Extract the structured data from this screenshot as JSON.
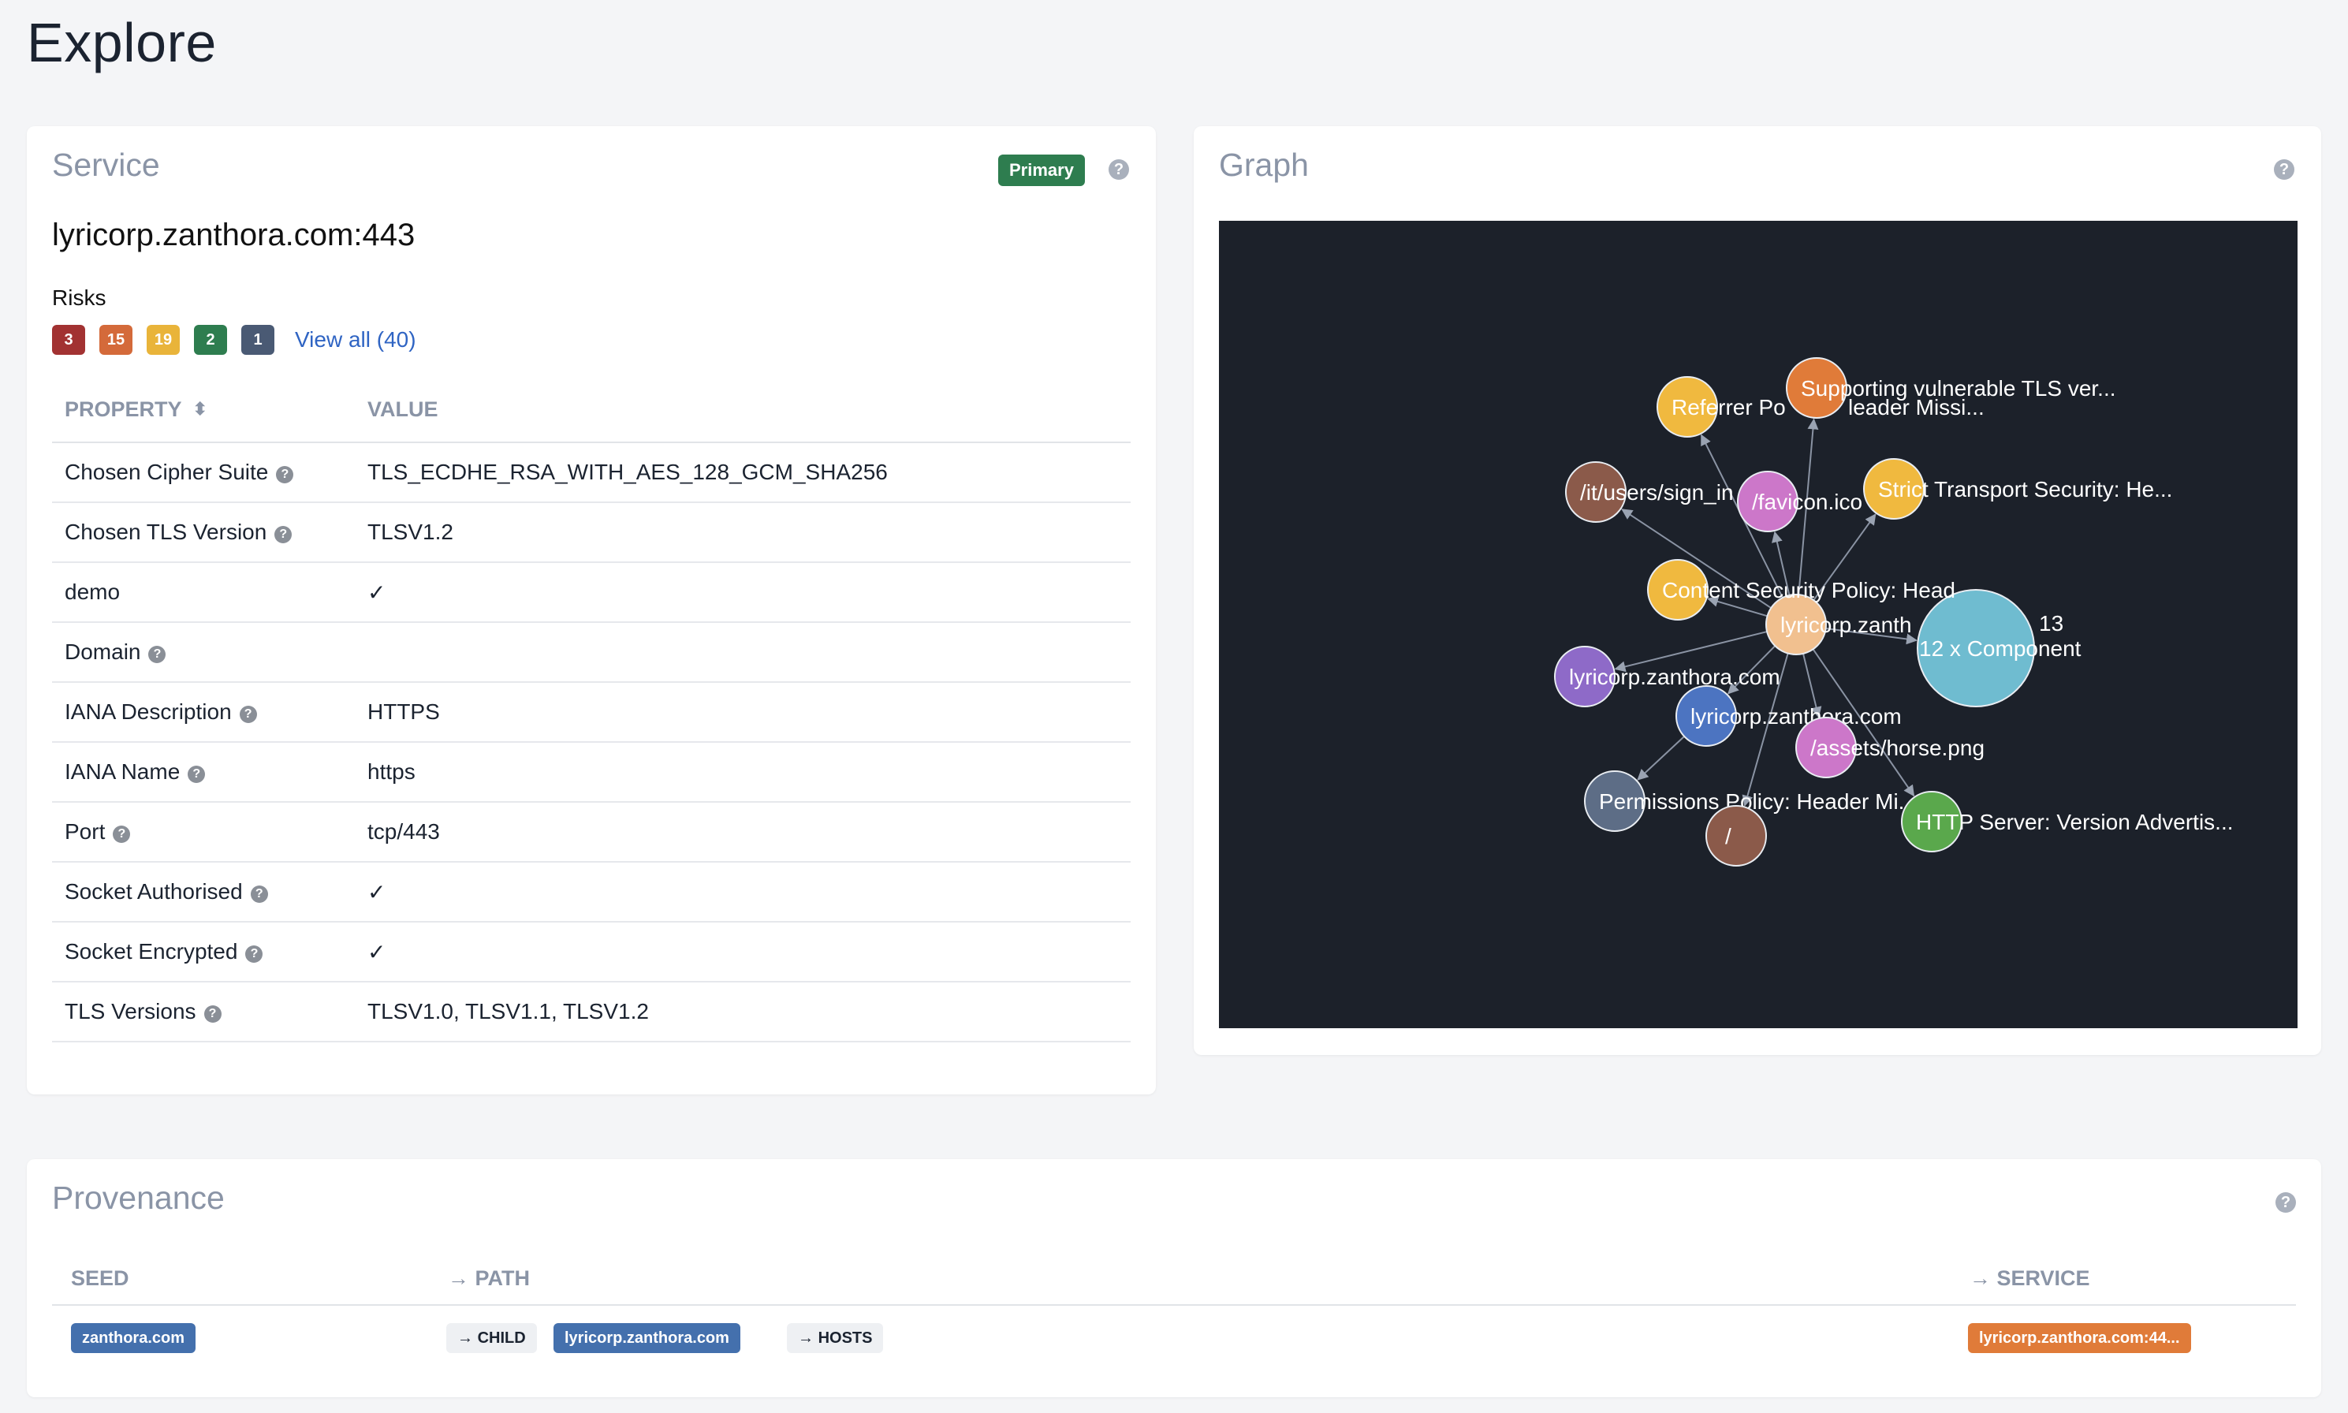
{
  "page": {
    "title": "Explore"
  },
  "service": {
    "title": "Service",
    "primary_badge": "Primary",
    "help": "?",
    "name": "lyricorp.zanthora.com:443",
    "risks_label": "Risks",
    "risks": [
      {
        "count": "3",
        "color": "#a23232"
      },
      {
        "count": "15",
        "color": "#d46a3a"
      },
      {
        "count": "19",
        "color": "#e9b43a"
      },
      {
        "count": "2",
        "color": "#2e7d4f"
      },
      {
        "count": "1",
        "color": "#4a5a74"
      }
    ],
    "view_all": "View all (40)",
    "table": {
      "headers": {
        "property": "PROPERTY",
        "value": "VALUE"
      },
      "rows": [
        {
          "property": "Chosen Cipher Suite",
          "help": true,
          "value": "TLS_ECDHE_RSA_WITH_AES_128_GCM_SHA256"
        },
        {
          "property": "Chosen TLS Version",
          "help": true,
          "value": "TLSV1.2"
        },
        {
          "property": "demo",
          "help": false,
          "value": "✓"
        },
        {
          "property": "Domain",
          "help": true,
          "value": ""
        },
        {
          "property": "IANA Description",
          "help": true,
          "value": "HTTPS"
        },
        {
          "property": "IANA Name",
          "help": true,
          "value": "https"
        },
        {
          "property": "Port",
          "help": true,
          "value": "tcp/443"
        },
        {
          "property": "Socket Authorised",
          "help": true,
          "value": "✓"
        },
        {
          "property": "Socket Encrypted",
          "help": true,
          "value": "✓"
        },
        {
          "property": "TLS Versions",
          "help": true,
          "value": "TLSV1.0, TLSV1.1, TLSV1.2"
        }
      ]
    }
  },
  "graph": {
    "title": "Graph",
    "help": "?",
    "background": "#1c212a",
    "nodes": [
      {
        "id": "center",
        "label": "lyricorp.zanth",
        "label2": "13",
        "color": "#f1c08f"
      },
      {
        "id": "component",
        "label": "12 x Component",
        "color": "#6fbcd0"
      },
      {
        "id": "referrer",
        "label": "Referrer Po",
        "color": "#f0b93f"
      },
      {
        "id": "supporting",
        "label": "Supporting vulnerable TLS ver...",
        "color": "#e07b39"
      },
      {
        "id": "header-missing",
        "label": "leader Missi...",
        "color": "#e07b39"
      },
      {
        "id": "signin",
        "label": "/it/users/sign_in",
        "color": "#8b5a4a"
      },
      {
        "id": "favicon",
        "label": "/favicon.ico",
        "color": "#cc77c9"
      },
      {
        "id": "strict",
        "label": "Strict Transport Security: He...",
        "color": "#f0b93f"
      },
      {
        "id": "csp",
        "label": "Content Security Policy: Head",
        "color": "#f0b93f"
      },
      {
        "id": "lyricorp-purple",
        "label": "lyricorp.zanthora.com",
        "color": "#8e6ac8"
      },
      {
        "id": "lyricorp-blue",
        "label": "lyricorp.zanthora.com",
        "color": "#4c74c1"
      },
      {
        "id": "horse",
        "label": "/assets/horse.png",
        "color": "#cc77c9"
      },
      {
        "id": "permissions",
        "label": "Permissions Policy: Header Mi...",
        "color": "#5d6d86"
      },
      {
        "id": "root",
        "label": "/",
        "color": "#8b5a4a"
      },
      {
        "id": "http-server",
        "label": "HTTP Server: Version Advertis...",
        "color": "#5aa84c"
      }
    ]
  },
  "provenance": {
    "title": "Provenance",
    "help": "?",
    "headers": {
      "seed": "SEED",
      "path": "PATH",
      "service": "SERVICE"
    },
    "row": {
      "seed": "zanthora.com",
      "path": [
        {
          "type": "edge",
          "label": "CHILD"
        },
        {
          "type": "node",
          "label": "lyricorp.zanthora.com"
        },
        {
          "type": "edge",
          "label": "HOSTS"
        }
      ],
      "service": "lyricorp.zanthora.com:44..."
    }
  }
}
